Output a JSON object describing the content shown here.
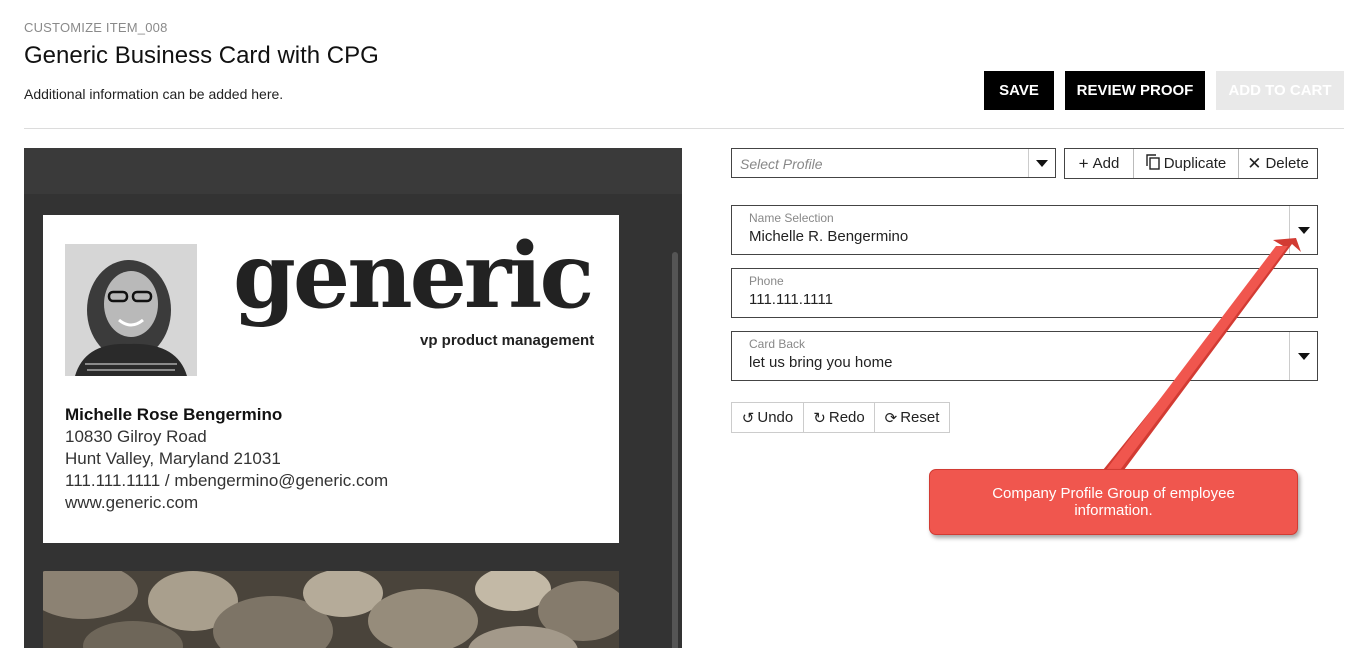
{
  "header": {
    "item_code": "CUSTOMIZE ITEM_008",
    "title": "Generic Business Card with CPG",
    "description": "Additional information can be added here."
  },
  "toolbar": {
    "save_label": "SAVE",
    "review_proof_label": "REVIEW PROOF",
    "add_to_cart_label": "ADD TO CART"
  },
  "preview": {
    "card_front": {
      "logo": "generic",
      "logo_subtitle": "vp product management",
      "name": "Michelle Rose Bengermino",
      "address_line1": "10830 Gilroy Road",
      "address_line2": "Hunt Valley, Maryland 21031",
      "contact_line": "111.111.1111 / mbengermino@generic.com",
      "website": "www.generic.com"
    }
  },
  "profile": {
    "placeholder": "Select Profile",
    "actions": {
      "add": "Add",
      "duplicate": "Duplicate",
      "delete": "Delete"
    }
  },
  "fields": {
    "name_selection": {
      "label": "Name Selection",
      "value": "Michelle R. Bengermino"
    },
    "phone": {
      "label": "Phone",
      "value": "111.111.1111"
    },
    "card_back": {
      "label": "Card Back",
      "value": "let us bring you home"
    }
  },
  "history": {
    "undo": "Undo",
    "redo": "Redo",
    "reset": "Reset"
  },
  "callout": {
    "text": "Company Profile Group of employee information.",
    "color": "#f0564e"
  },
  "colors": {
    "primary_button": "#000000",
    "disabled_button": "#e9e9e9",
    "preview_background": "#333333"
  }
}
